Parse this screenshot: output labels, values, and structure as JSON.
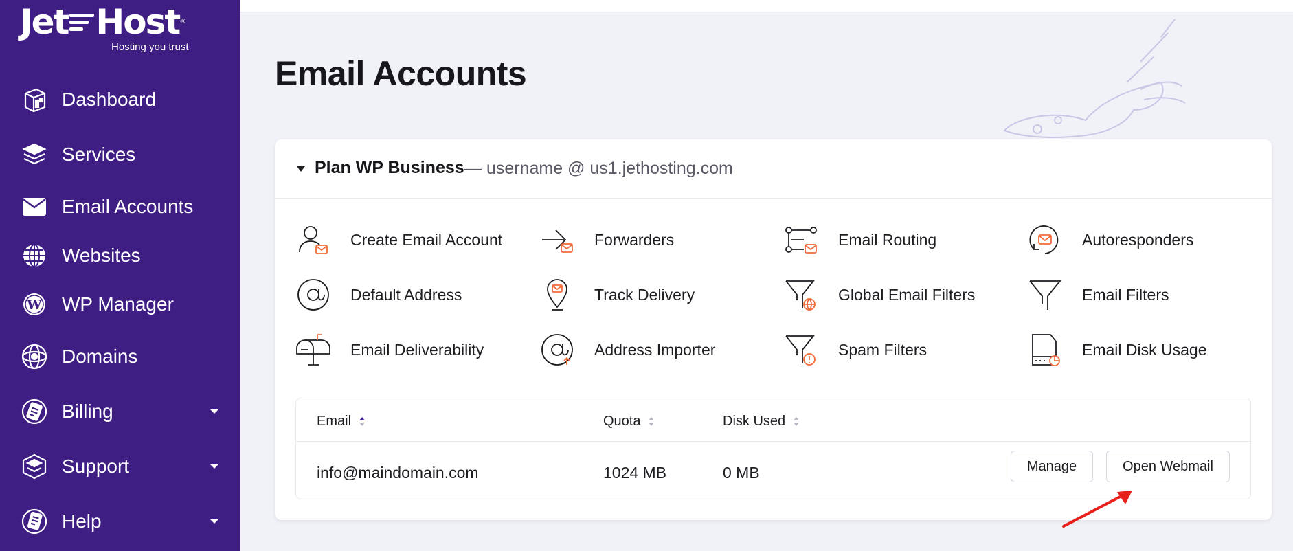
{
  "brand": {
    "name_left": "Jet",
    "name_right": "Host",
    "registered": "®",
    "tagline": "Hosting you trust"
  },
  "sidebar": {
    "items": [
      {
        "label": "Dashboard",
        "icon": "dashboard-icon",
        "has_caret": false
      },
      {
        "label": "Services",
        "icon": "services-icon",
        "has_caret": false
      },
      {
        "label": "Email Accounts",
        "icon": "envelope-icon",
        "has_caret": false
      },
      {
        "label": "Websites",
        "icon": "globe-icon",
        "has_caret": false
      },
      {
        "label": "WP Manager",
        "icon": "wordpress-icon",
        "has_caret": false
      },
      {
        "label": "Domains",
        "icon": "domains-icon",
        "has_caret": false
      },
      {
        "label": "Billing",
        "icon": "billing-icon",
        "has_caret": true
      },
      {
        "label": "Support",
        "icon": "support-icon",
        "has_caret": true
      },
      {
        "label": "Help",
        "icon": "help-icon",
        "has_caret": true
      }
    ]
  },
  "main": {
    "title": "Email Accounts",
    "plan": {
      "name": "Plan WP Business",
      "details": "— username @ us1.jethosting.com"
    },
    "tools": [
      {
        "label": "Create Email Account",
        "icon": "create-email-account-icon"
      },
      {
        "label": "Forwarders",
        "icon": "forwarders-icon"
      },
      {
        "label": "Email Routing",
        "icon": "email-routing-icon"
      },
      {
        "label": "Autoresponders",
        "icon": "autoresponders-icon"
      },
      {
        "label": "Default Address",
        "icon": "at-sign-icon"
      },
      {
        "label": "Track Delivery",
        "icon": "track-delivery-icon"
      },
      {
        "label": "Global Email Filters",
        "icon": "global-filter-icon"
      },
      {
        "label": "Email Filters",
        "icon": "filter-icon"
      },
      {
        "label": "Email Deliverability",
        "icon": "mailbox-icon"
      },
      {
        "label": "Address Importer",
        "icon": "address-importer-icon"
      },
      {
        "label": "Spam Filters",
        "icon": "spam-filter-icon"
      },
      {
        "label": "Email Disk Usage",
        "icon": "disk-usage-icon"
      }
    ],
    "table": {
      "columns": [
        "Email",
        "Quota",
        "Disk Used"
      ],
      "rows": [
        {
          "email": "info@maindomain.com",
          "quota": "1024 MB",
          "disk_used": "0 MB"
        }
      ],
      "manage_label": "Manage",
      "webmail_label": "Open Webmail"
    }
  },
  "colors": {
    "sidebar": "#3f1e84",
    "accent_orange": "#f26b3a",
    "annotation_arrow": "#e8201c"
  }
}
